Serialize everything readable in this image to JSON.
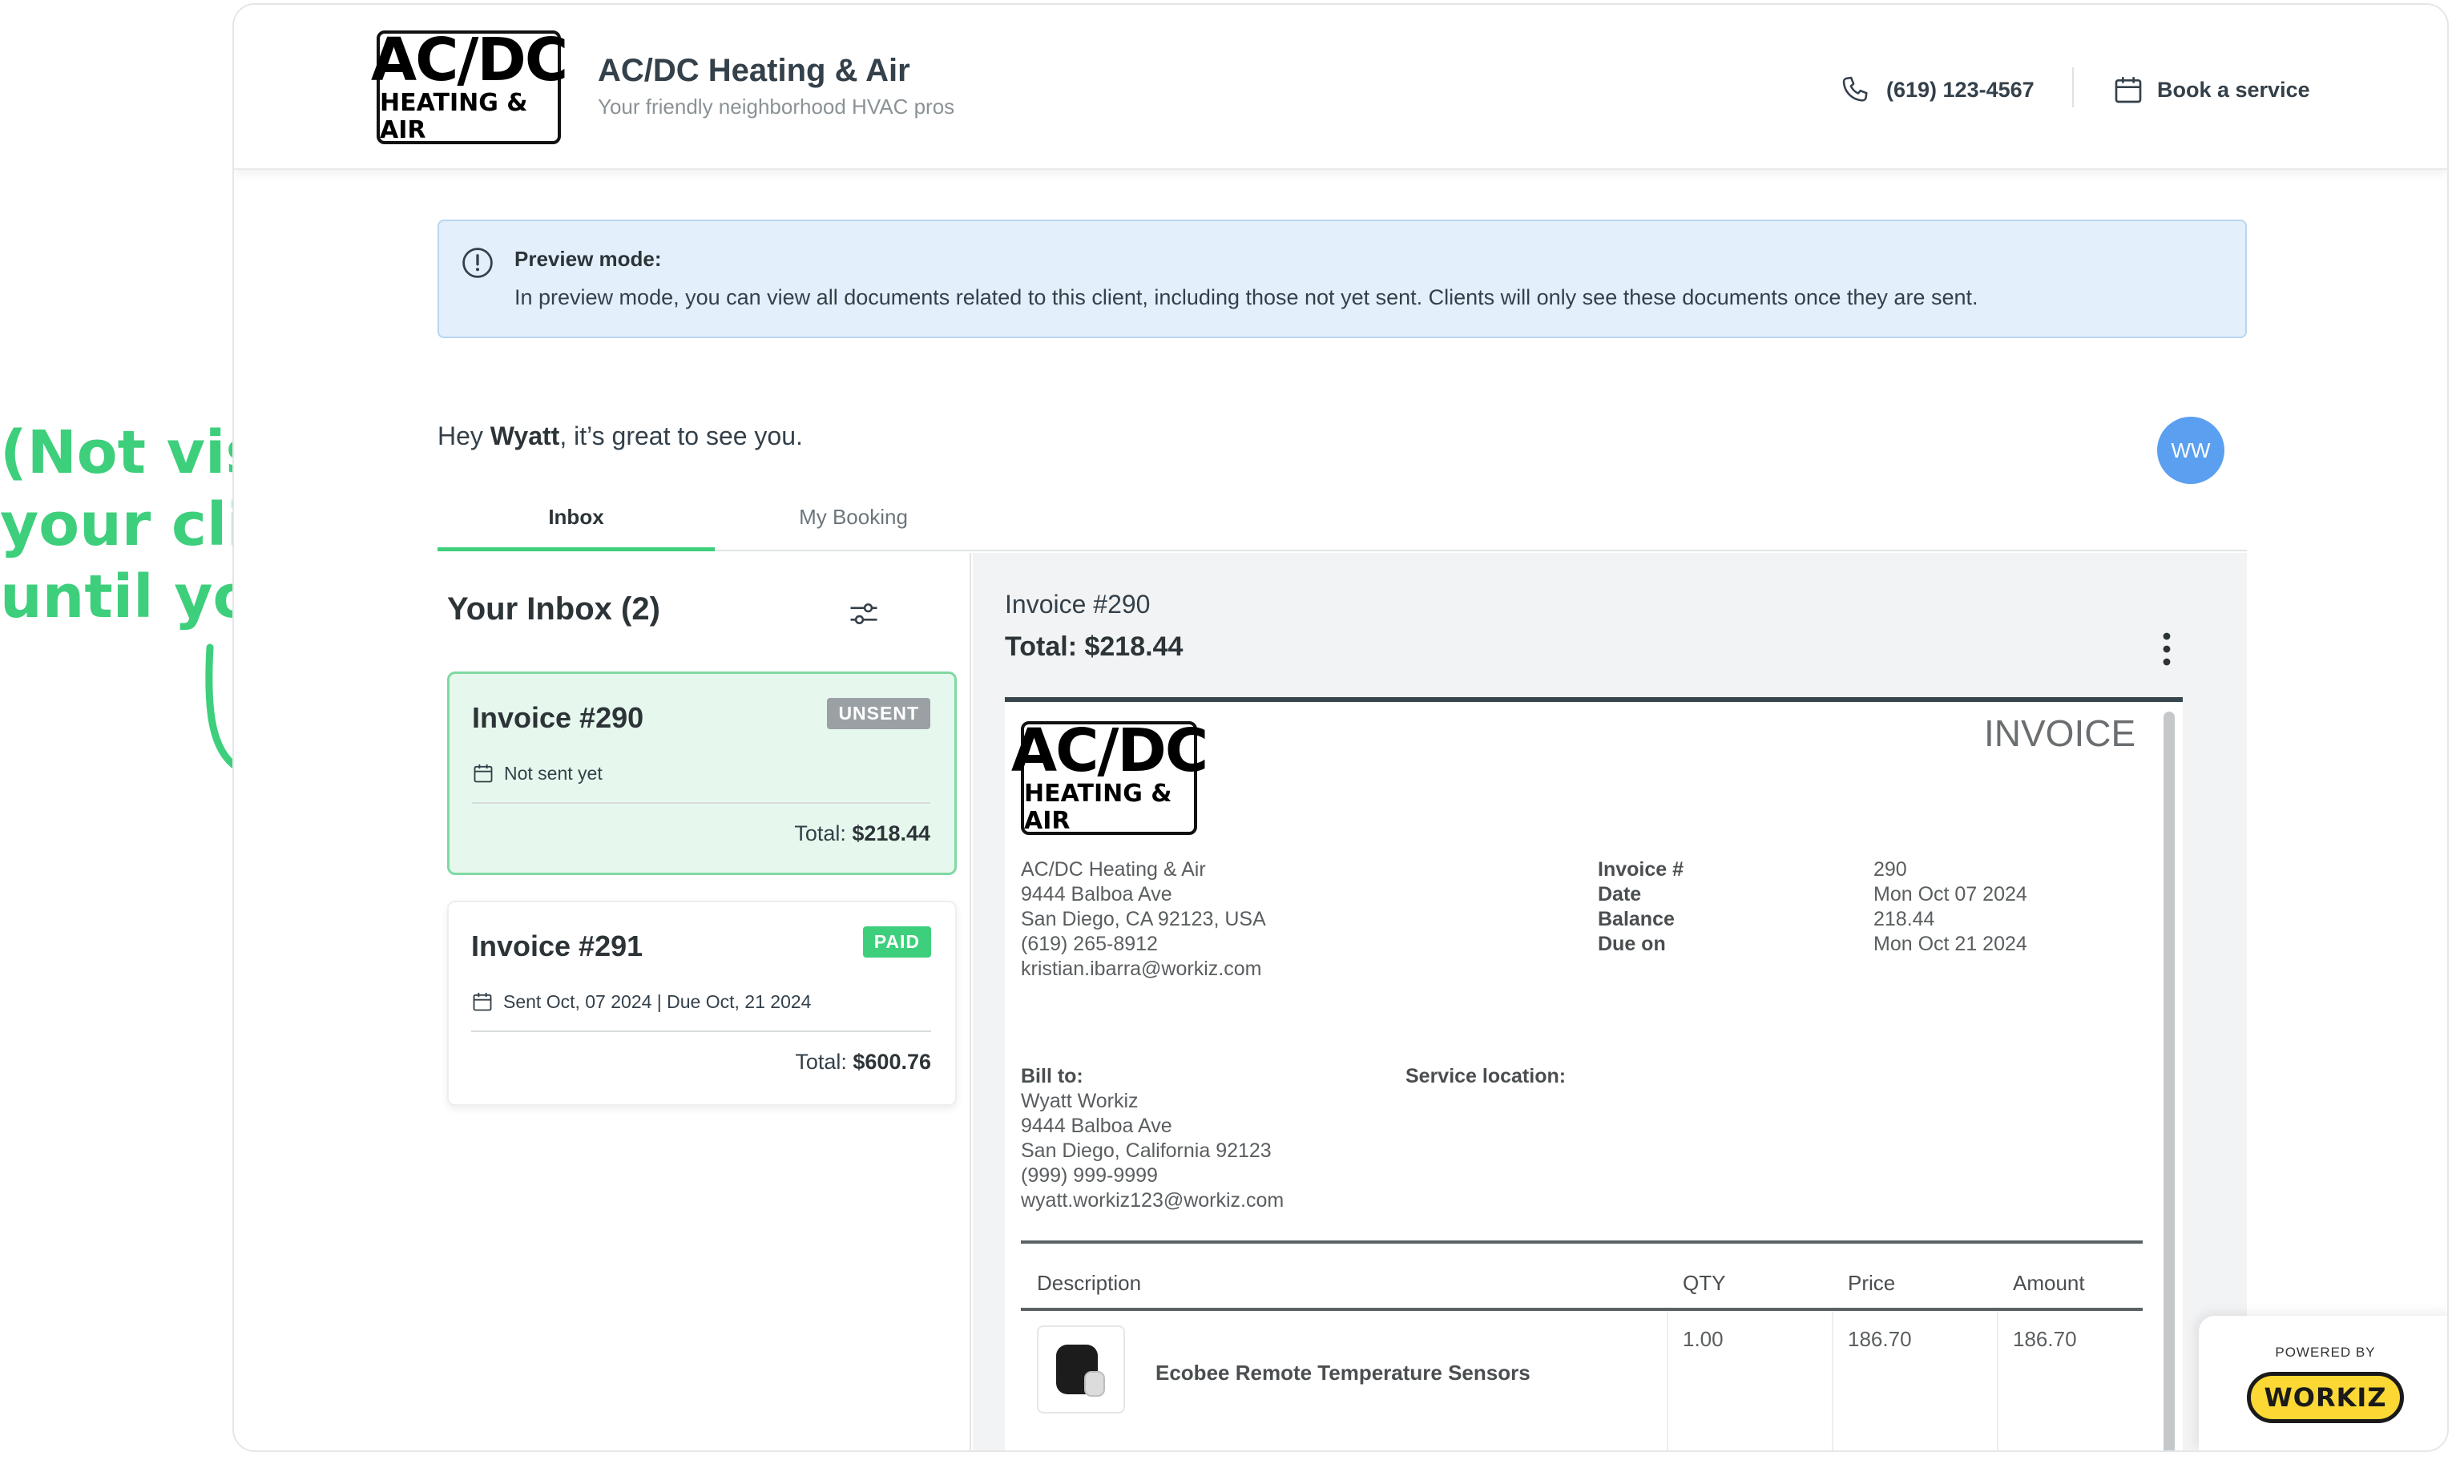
{
  "annotation": {
    "lines": [
      "(Not visible to",
      "your clients",
      "until you send)"
    ],
    "color": "#3ecf7c"
  },
  "header": {
    "logo": {
      "big": "AC/DC",
      "small": "HEATING & AIR"
    },
    "business_name": "AC/DC Heating & Air",
    "tagline": "Your friendly neighborhood HVAC pros",
    "phone": "(619) 123-4567",
    "book_label": "Book a service"
  },
  "preview": {
    "title": "Preview mode:",
    "text": "In preview mode, you can view all documents related to this client, including those not yet sent. Clients will only see these documents once they are sent."
  },
  "greeting": {
    "prefix": "Hey ",
    "name": "Wyatt",
    "suffix": ", it’s great to see you."
  },
  "avatar": {
    "initials": "WW",
    "color": "#5a9ff0"
  },
  "tabs": [
    {
      "label": "Inbox",
      "active": true
    },
    {
      "label": "My Booking",
      "active": false
    }
  ],
  "inbox": {
    "title": "Your Inbox (2)",
    "cards": [
      {
        "title": "Invoice #290",
        "badge": "UNSENT",
        "date": "Not sent yet",
        "total_label": "Total:",
        "total": "$218.44"
      },
      {
        "title": "Invoice #291",
        "badge": "PAID",
        "date": "Sent Oct, 07 2024 | Due Oct, 21 2024",
        "total_label": "Total:",
        "total": "$600.76"
      }
    ]
  },
  "detail": {
    "invoice_label": "Invoice #290",
    "total": "Total: $218.44",
    "doc": {
      "heading": "INVOICE",
      "from": [
        "AC/DC Heating & Air",
        "9444 Balboa Ave",
        "San Diego, CA 92123, USA",
        "(619) 265-8912",
        "kristian.ibarra@workiz.com"
      ],
      "meta_keys": [
        "Invoice #",
        "Date",
        "Balance",
        "Due on"
      ],
      "meta_values": [
        "290",
        "Mon Oct 07 2024",
        "218.44",
        "Mon Oct 21 2024"
      ],
      "bill_to_label": "Bill to:",
      "bill_to": [
        "Wyatt Workiz",
        "9444 Balboa Ave",
        "San Diego, California 92123",
        "(999) 999-9999",
        "wyatt.workiz123@workiz.com"
      ],
      "service_location_label": "Service location:",
      "table": {
        "headers": [
          "Description",
          "QTY",
          "Price",
          "Amount"
        ],
        "rows": [
          {
            "description": "Ecobee Remote Temperature Sensors",
            "qty": "1.00",
            "price": "186.70",
            "amount": "186.70"
          }
        ]
      }
    }
  },
  "powered": {
    "label": "POWERED BY",
    "brand": "WORKIZ"
  },
  "colors": {
    "accent": "#3ecf7c",
    "preview_bg": "#e3effb",
    "badge_unsent": "#9aa0a4",
    "badge_paid": "#3ecf7c",
    "workiz_yellow": "#fcd835"
  }
}
